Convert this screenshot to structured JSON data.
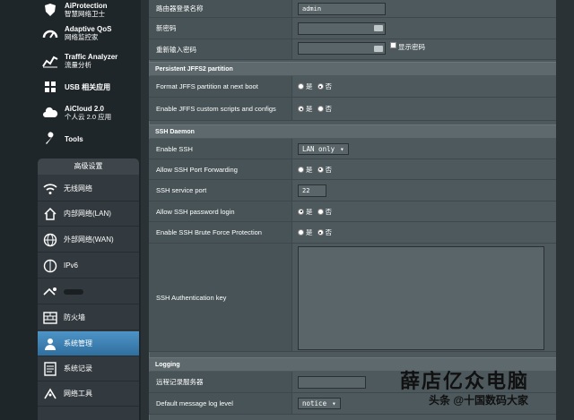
{
  "sidebar": {
    "top_items": [
      {
        "icon": "shield-icon",
        "line1": "AiProtection",
        "line2": "智慧网络卫士"
      },
      {
        "icon": "qos-gauge-icon",
        "line1": "Adaptive QoS",
        "line2": "网络监控家"
      },
      {
        "icon": "chart-icon",
        "line1": "Traffic Analyzer",
        "line2": "流量分析"
      },
      {
        "icon": "puzzle-icon",
        "line1": "USB 相关应用",
        "line2": ""
      },
      {
        "icon": "cloud-icon",
        "line1": "AiCloud 2.0",
        "line2": "个人云 2.0 应用"
      },
      {
        "icon": "wrench-icon",
        "line1": "Tools",
        "line2": ""
      }
    ],
    "advanced_header": "高级设置",
    "advanced_items": [
      {
        "icon": "wifi-icon",
        "label": "无线网络"
      },
      {
        "icon": "home-icon",
        "label": "内部网络(LAN)"
      },
      {
        "icon": "globe-icon",
        "label": "外部网络(WAN)"
      },
      {
        "icon": "ipv6-icon",
        "label": "IPv6"
      },
      {
        "icon": "vpn-icon",
        "label": ""
      },
      {
        "icon": "firewall-icon",
        "label": "防火墙"
      },
      {
        "icon": "admin-icon",
        "label": "系统管理"
      },
      {
        "icon": "log-icon",
        "label": "系统记录"
      },
      {
        "icon": "network-tools-icon",
        "label": "网络工具"
      }
    ]
  },
  "form": {
    "login_name_label": "路由器登录名称",
    "login_name_value": "admin",
    "new_password_label": "新密码",
    "retype_password_label": "重新输入密码",
    "show_password_label": "显示密码",
    "jffs_section": "Persistent JFFS2 partition",
    "jffs_format_label": "Format JFFS partition at next boot",
    "jffs_scripts_label": "Enable JFFS custom scripts and configs",
    "yes": "是",
    "no": "否",
    "ssh_section": "SSH Daemon",
    "enable_ssh_label": "Enable SSH",
    "enable_ssh_value": "LAN only",
    "port_forwarding_label": "Allow SSH Port Forwarding",
    "ssh_port_label": "SSH service port",
    "ssh_port_value": "22",
    "password_login_label": "Allow SSH password login",
    "brute_force_label": "Enable SSH Brute Force Protection",
    "auth_key_label": "SSH Authentication key",
    "logging_section": "Logging",
    "remote_log_label": "远程记录服务器",
    "log_level_label": "Default message log level",
    "log_level_value": "notice"
  },
  "watermark": {
    "line1": "薛店亿众电脑",
    "line2": "头条 @十国数码大家"
  }
}
